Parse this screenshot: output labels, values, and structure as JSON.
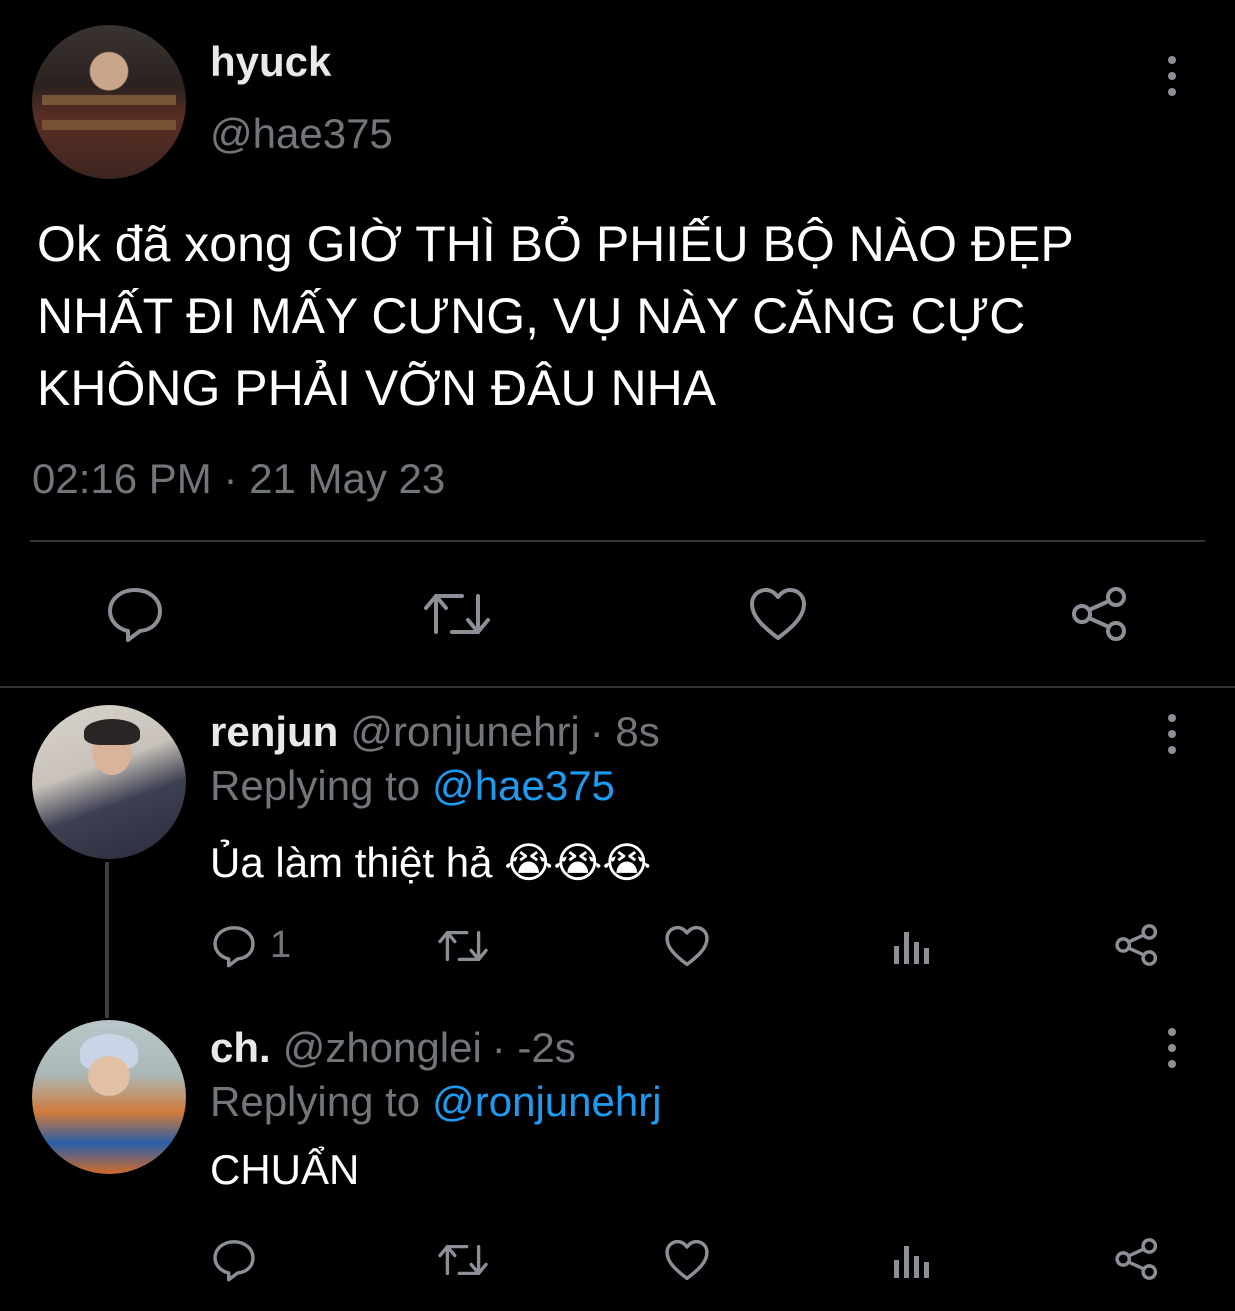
{
  "main_tweet": {
    "display_name": "hyuck",
    "handle": "@hae375",
    "text_lines": [
      "Ok đã xong GIỜ THÌ BỎ PHIẾU BỘ NÀO ĐẸP",
      "NHẤT ĐI MẤY CƯNG, VỤ NÀY CĂNG CỰC",
      "KHÔNG PHẢI VỠN ĐÂU NHA"
    ],
    "timestamp": "02:16 PM · 21 May 23"
  },
  "replies": [
    {
      "display_name": "renjun",
      "handle": "@ronjunehrj",
      "time": "· 8s",
      "replying_prefix": "Replying to",
      "replying_to": "@hae375",
      "text": "Ủa làm thiệt hả 😭😭😭",
      "reply_count": "1"
    },
    {
      "display_name": "ch.",
      "handle": "@zhonglei",
      "time": "· -2s",
      "replying_prefix": "Replying to",
      "replying_to": "@ronjunehrj",
      "text": "CHUẨN",
      "reply_count": ""
    }
  ],
  "icons": {
    "reply": "reply-icon",
    "retweet": "retweet-icon",
    "like": "heart-icon",
    "share": "share-icon",
    "views": "views-icon",
    "more": "more-options-icon"
  },
  "colors": {
    "background": "#000000",
    "text": "#e7e9ea",
    "muted": "#71767b",
    "link": "#1d9bf0",
    "divider": "#2f3336"
  }
}
